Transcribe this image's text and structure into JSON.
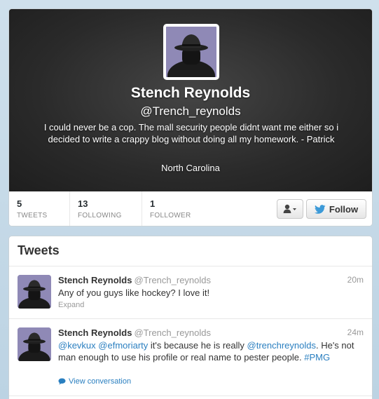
{
  "profile": {
    "name": "Stench Reynolds",
    "handle": "@Trench_reynolds",
    "bio": "I could never be a cop. The mall security people didnt want me either so i decided to write a crappy blog without doing all my homework. - Patrick",
    "location": "North Carolina",
    "avatar_icon": "avatar-icon"
  },
  "stats": {
    "tweets": {
      "num": "5",
      "label": "TWEETS"
    },
    "following": {
      "num": "13",
      "label": "FOLLOWING"
    },
    "followers": {
      "num": "1",
      "label": "FOLLOWER"
    }
  },
  "actions": {
    "user_menu_icon": "person-dropdown-icon",
    "follow_label": "Follow",
    "follow_icon": "bird-icon"
  },
  "tweets_section": {
    "title": "Tweets",
    "items": [
      {
        "name": "Stench Reynolds",
        "handle": "@Trench_reynolds",
        "time": "20m",
        "text": "Any of you guys like hockey? I love it!",
        "action": "Expand"
      },
      {
        "name": "Stench Reynolds",
        "handle": "@Trench_reynolds",
        "time": "24m",
        "mention1": "@kevkux",
        "mention2": "@efmoriarty",
        "text_mid": " it's because he is really ",
        "mention3": "@trenchreynolds",
        "text_end": ". He's not man enough to use his profile or real name to pester people. ",
        "hashtag": "#PMG",
        "action": "View conversation"
      }
    ]
  },
  "colors": {
    "link": "#2a7fc0",
    "header_bg": "#2b2b2b",
    "avatar_bg": "#8f89b6"
  }
}
